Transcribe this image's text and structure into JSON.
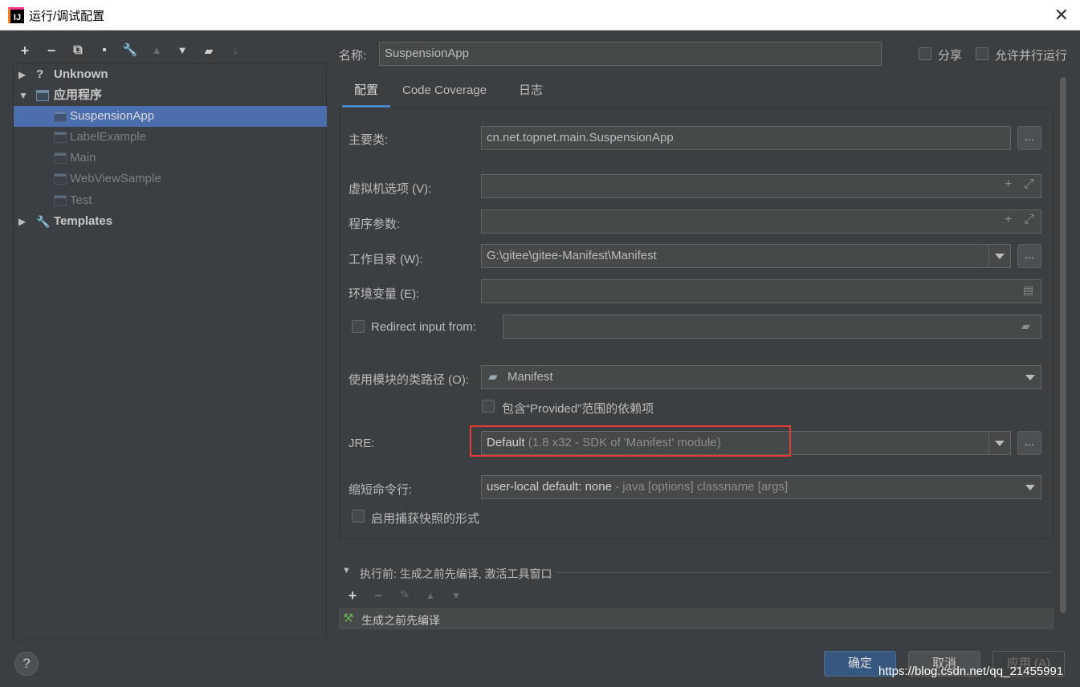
{
  "window": {
    "title": "运行/调试配置",
    "app_icon_text": "IJ",
    "close_glyph": "✕"
  },
  "toolbar": {
    "add": "+",
    "remove": "−",
    "copy": "⧉",
    "save": "▪",
    "wrench": "🔧",
    "up": "▲",
    "down": "▼",
    "folder": "▰",
    "sort": "↓"
  },
  "tree": {
    "unknown": {
      "label": "Unknown",
      "icon": "?"
    },
    "application": {
      "label": "应用程序"
    },
    "items": [
      {
        "label": "SuspensionApp"
      },
      {
        "label": "LabelExample"
      },
      {
        "label": "Main"
      },
      {
        "label": "WebViewSample"
      },
      {
        "label": "Test"
      }
    ],
    "templates": {
      "label": "Templates"
    }
  },
  "header": {
    "name_label": "名称:",
    "name_value": "SuspensionApp",
    "share_label": "分享",
    "parallel_label": "允许并行运行"
  },
  "tabs": [
    {
      "label": "配置"
    },
    {
      "label": "Code Coverage"
    },
    {
      "label": "日志"
    }
  ],
  "form": {
    "main_class": {
      "label": "主要类:",
      "value": "cn.net.topnet.main.SuspensionApp"
    },
    "vm_options": {
      "label": "虚拟机选项 (V):",
      "value": ""
    },
    "program_args": {
      "label": "程序参数:",
      "value": ""
    },
    "working_dir": {
      "label": "工作目录 (W):",
      "value": "G:\\gitee\\gitee-Manifest\\Manifest"
    },
    "env_vars": {
      "label": "环境变量 (E):",
      "value": ""
    },
    "redirect": {
      "label": "Redirect input from:",
      "value": ""
    },
    "module_classpath": {
      "label": "使用模块的类路径 (O):",
      "value": "Manifest"
    },
    "provided_scope": {
      "label": "包含“Provided”范围的依赖项"
    },
    "jre": {
      "label": "JRE:",
      "value_main": "Default",
      "value_hint": "(1.8 x32 - SDK of 'Manifest' module)"
    },
    "shorten_cmd": {
      "label": "缩短命令行:",
      "value_main": "user-local default: none",
      "value_hint": "- java [options] classname [args]"
    },
    "snapshot": {
      "label": "启用捕获快照的形式"
    },
    "dots": "...",
    "plus": "+",
    "expand": "⤢"
  },
  "before_launch": {
    "title": "执行前: 生成之前先编译, 激活工具窗口",
    "items": [
      {
        "label": "生成之前先编译"
      }
    ]
  },
  "buttons": {
    "ok": "确定",
    "cancel": "取消",
    "apply": "应用 (A)",
    "help": "?"
  },
  "watermark": "https://blog.csdn.net/qq_21455991",
  "colors": {
    "accent": "#4b6eaf",
    "highlight": "#e53935",
    "background": "#3c3f41"
  }
}
